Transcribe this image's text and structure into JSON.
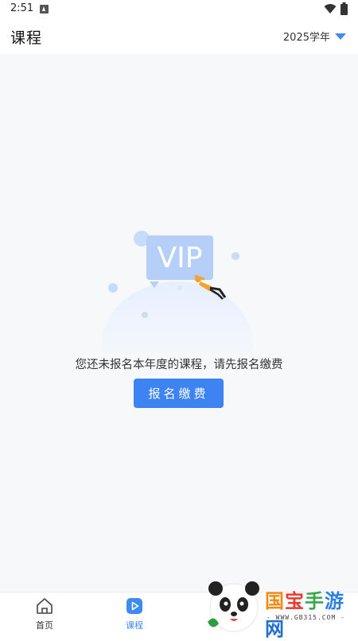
{
  "status_bar": {
    "time": "2:51"
  },
  "header": {
    "title": "课程",
    "year_label": "2025学年"
  },
  "empty_state": {
    "illustration_text": "VIP",
    "message": "您还未报名本年度的课程，请先报名缴费",
    "button_label": "报名缴费"
  },
  "tabs": [
    {
      "label": "首页",
      "icon": "home-icon",
      "active": false
    },
    {
      "label": "课程",
      "icon": "play-icon",
      "active": true
    }
  ],
  "watermark": {
    "text": "国宝手游网",
    "url": "WWW.GB315.COM"
  },
  "colors": {
    "accent": "#3f8af2",
    "button": "#3d84f2",
    "background": "#f7f8fa"
  }
}
